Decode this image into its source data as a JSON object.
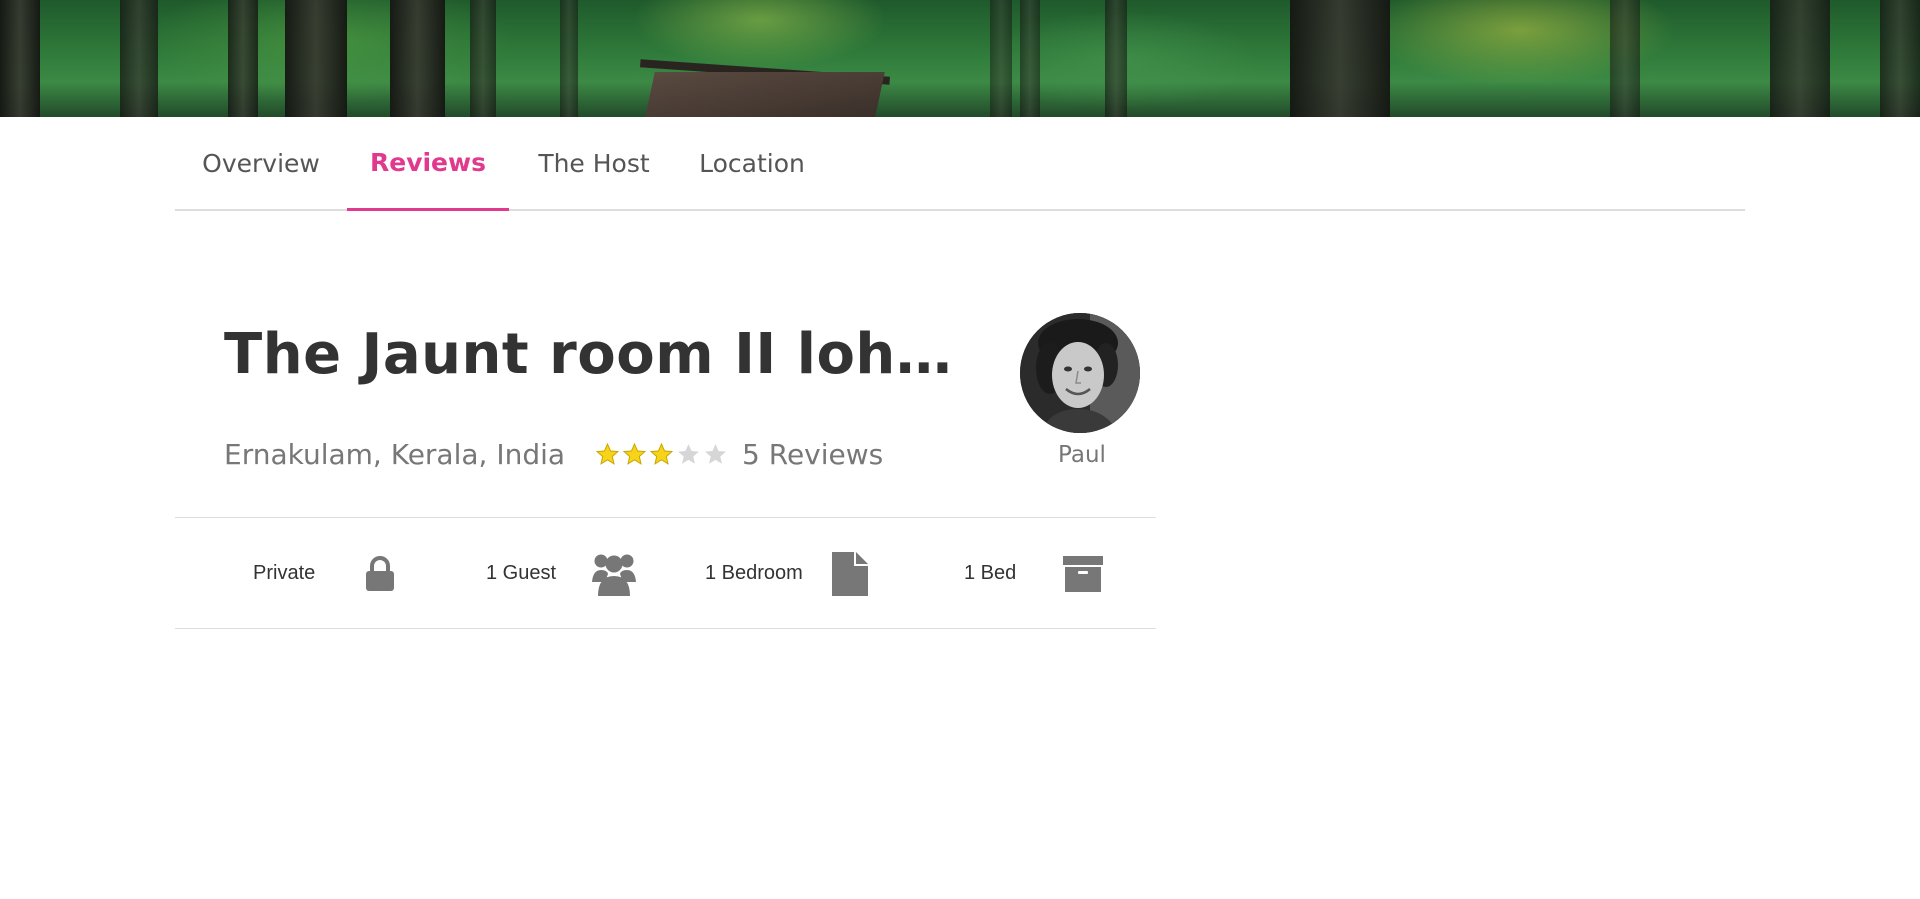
{
  "tabs": [
    {
      "label": "Overview"
    },
    {
      "label": "Reviews"
    },
    {
      "label": "The Host"
    },
    {
      "label": "Location"
    }
  ],
  "active_tab": "Reviews",
  "listing": {
    "title": "The Jaunt room II loher...",
    "location": "Ernakulam, Kerala, India",
    "rating": 3,
    "rating_max": 5,
    "reviews_label": "5 Reviews"
  },
  "host": {
    "name": "Paul"
  },
  "amenities": [
    {
      "label": "Private",
      "icon": "lock-icon"
    },
    {
      "label": "1 Guest",
      "icon": "users-icon"
    },
    {
      "label": "1 Bedroom",
      "icon": "file-icon"
    },
    {
      "label": "1 Bed",
      "icon": "archive-box-icon"
    }
  ],
  "colors": {
    "accent": "#e0398e",
    "star_filled": "#f7d417",
    "star_empty": "#d6d6d6",
    "icon_gray": "#777777",
    "divider": "#dddddd"
  }
}
